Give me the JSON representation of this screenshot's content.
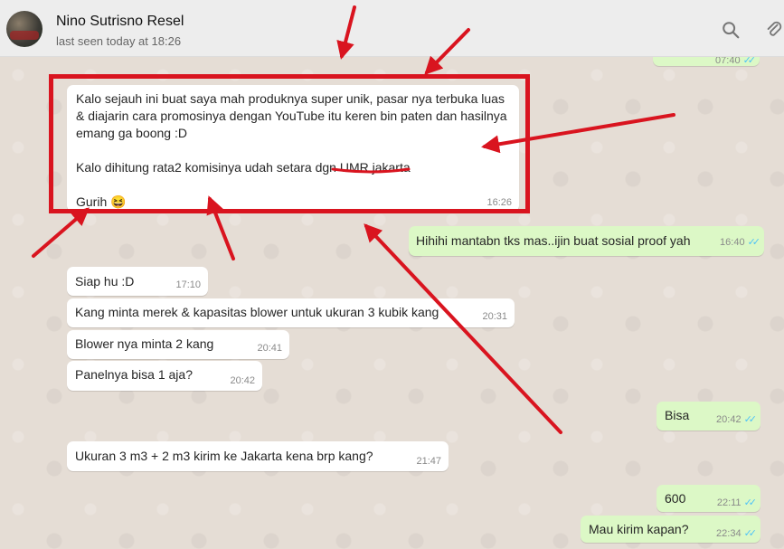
{
  "header": {
    "contact_name": "Nino Sutrisno Resel",
    "status": "last seen today at 18:26",
    "icons": [
      "avatar",
      "search-icon",
      "attach-icon"
    ]
  },
  "messages": [
    {
      "dir": "out",
      "text": "",
      "time": "07:40",
      "ticks": "✓✓"
    },
    {
      "dir": "in",
      "text": "Kalo sejauh ini buat saya mah produknya super unik, pasar nya terbuka luas & diajarin cara promosinya dengan YouTube itu keren bin paten dan hasilnya emang ga boong :D\n\nKalo dihitung rata2 komisinya udah setara dgn UMR jakarta\n\nGurih 😆",
      "time": "16:26"
    },
    {
      "dir": "out",
      "text": "Hihihi mantabn tks mas..ijin buat sosial proof yah",
      "time": "16:40",
      "ticks": "✓✓"
    },
    {
      "dir": "in",
      "text": "Siap hu :D",
      "time": "17:10"
    },
    {
      "dir": "in",
      "text": "Kang minta merek & kapasitas blower untuk ukuran 3 kubik kang",
      "time": "20:31"
    },
    {
      "dir": "in",
      "text": "Blower nya minta 2 kang",
      "time": "20:41"
    },
    {
      "dir": "in",
      "text": "Panelnya bisa 1 aja?",
      "time": "20:42"
    },
    {
      "dir": "out",
      "text": "Bisa",
      "time": "20:42",
      "ticks": "✓✓"
    },
    {
      "dir": "in",
      "text": "Ukuran 3 m3 + 2 m3 kirim ke Jakarta kena brp kang?",
      "time": "21:47"
    },
    {
      "dir": "out",
      "text": "600",
      "time": "22:11",
      "ticks": "✓✓"
    },
    {
      "dir": "out",
      "text": "Mau kirim kapan?",
      "time": "22:34",
      "ticks": "✓✓"
    }
  ],
  "colors": {
    "incoming": "#ffffff",
    "outgoing": "#dcf8c6",
    "annotation": "#d9141f",
    "read_ticks": "#4fc3f7"
  }
}
